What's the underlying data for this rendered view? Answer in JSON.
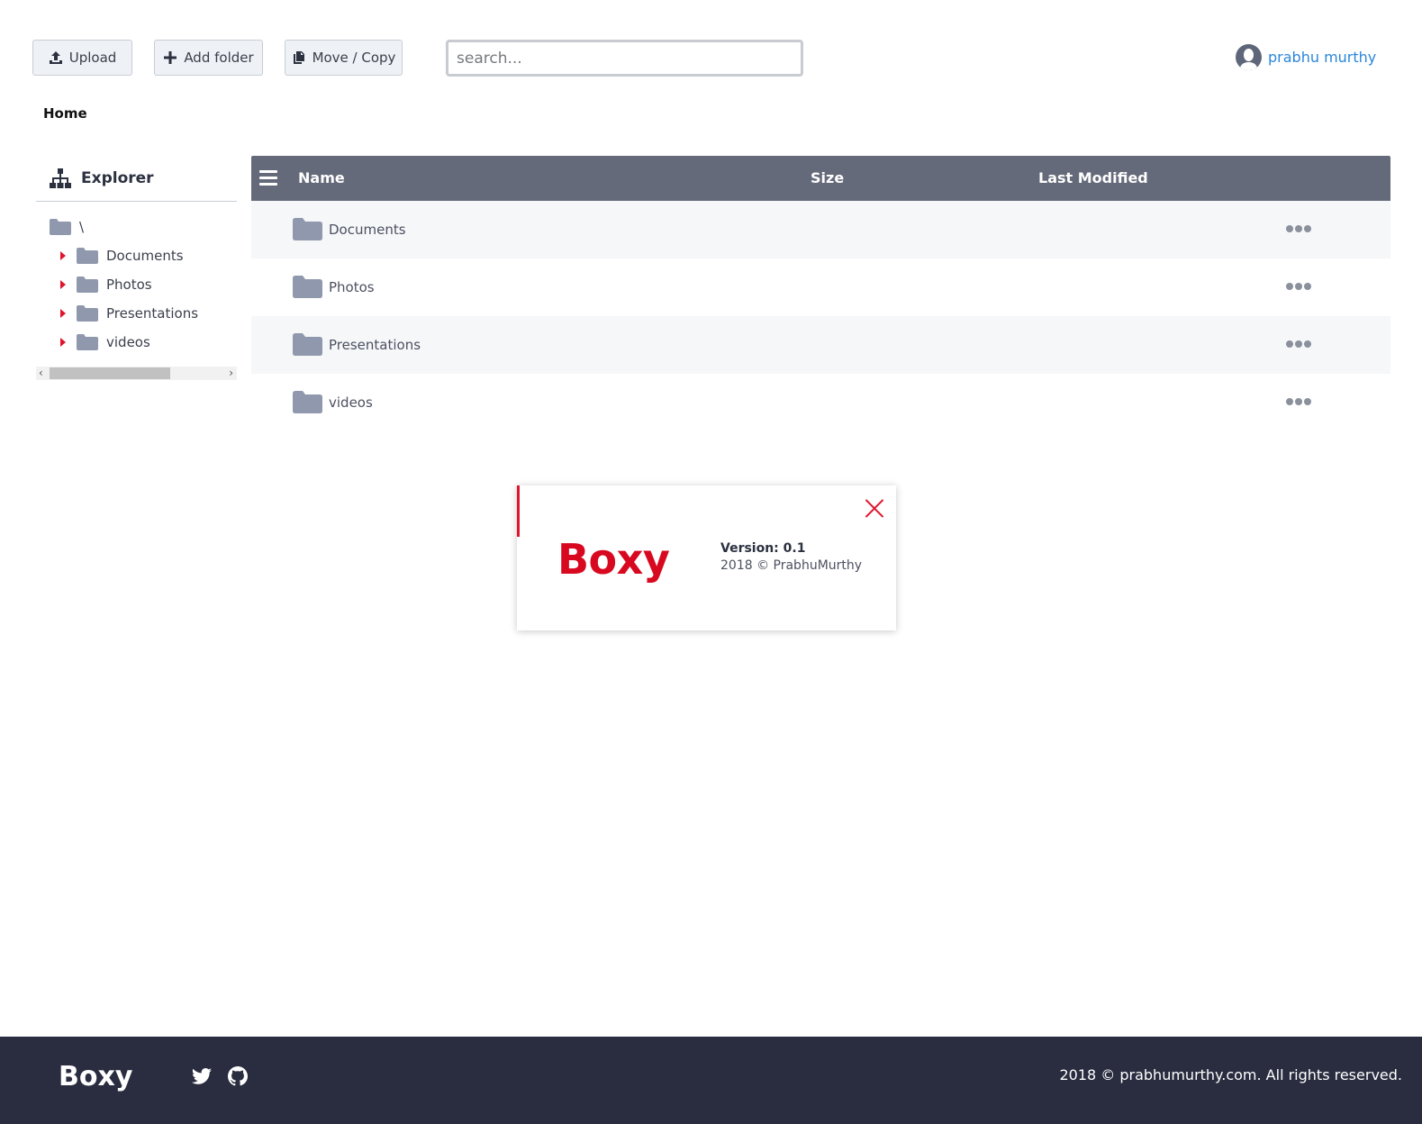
{
  "toolbar": {
    "upload_label": "Upload",
    "add_folder_label": "Add folder",
    "move_copy_label": "Move / Copy",
    "search_placeholder": "search..."
  },
  "user": {
    "name": "prabhu murthy"
  },
  "breadcrumb": {
    "current": "Home"
  },
  "explorer": {
    "title": "Explorer",
    "root_label": "\\",
    "items": [
      {
        "label": "Documents"
      },
      {
        "label": "Photos"
      },
      {
        "label": "Presentations"
      },
      {
        "label": "videos"
      }
    ]
  },
  "table": {
    "columns": {
      "name": "Name",
      "size": "Size",
      "modified": "Last Modified"
    },
    "rows": [
      {
        "name": "Documents",
        "size": "",
        "modified": ""
      },
      {
        "name": "Photos",
        "size": "",
        "modified": ""
      },
      {
        "name": "Presentations",
        "size": "",
        "modified": ""
      },
      {
        "name": "videos",
        "size": "",
        "modified": ""
      }
    ]
  },
  "about_modal": {
    "brand": "Boxy",
    "version": "Version: 0.1",
    "copyright": "2018 © PrabhuMurthy"
  },
  "footer": {
    "brand": "Boxy",
    "copyright": "2018 © prabhumurthy.com. All rights reserved."
  },
  "icons": {
    "upload": "upload-icon",
    "add": "plus-icon",
    "copy": "copy-icon",
    "explorer": "sitemap-icon",
    "folder": "folder-icon",
    "more": "ellipsis-icon",
    "close": "close-icon",
    "twitter": "twitter-icon",
    "github": "github-icon"
  },
  "colors": {
    "accent": "#e0142d",
    "header_bg": "#656a7a",
    "footer_bg": "#2a2d40",
    "link": "#2b86d9",
    "folder": "#8f98ad"
  }
}
